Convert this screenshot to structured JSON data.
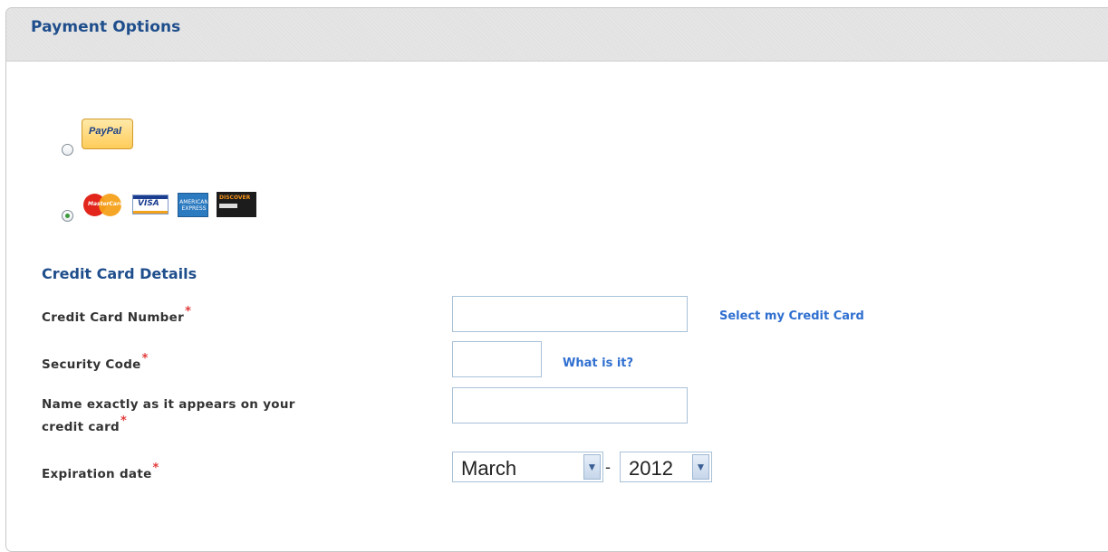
{
  "panel": {
    "title": "Payment Options"
  },
  "payment_methods": {
    "paypal": {
      "logo_text": "PayPal",
      "selected": false,
      "icon": "paypal-logo"
    },
    "cards": {
      "selected": true,
      "logos": [
        {
          "icon": "mastercard-logo",
          "text": "MasterCard"
        },
        {
          "icon": "visa-logo",
          "text": "VISA"
        },
        {
          "icon": "amex-logo",
          "text": "AMERICAN EXPRESS"
        },
        {
          "icon": "discover-logo",
          "text": "DISCOVER"
        }
      ]
    }
  },
  "credit_card_details": {
    "title": "Credit Card Details",
    "required_marker": "*",
    "card_number": {
      "label": "Credit Card Number",
      "value": "",
      "link": "Select my Credit Card"
    },
    "security_code": {
      "label": "Security Code",
      "value": "",
      "link": "What is it?"
    },
    "name_on_card": {
      "label_line1": "Name exactly as it appears on your",
      "label_line2": "credit card",
      "value": ""
    },
    "expiration": {
      "label": "Expiration date",
      "month": "March",
      "separator": "-",
      "year": "2012"
    }
  },
  "colors": {
    "heading": "#1f4e8c",
    "link": "#2f6fd0",
    "required": "#e23b3b",
    "header_bg": "#e2e2e2"
  }
}
